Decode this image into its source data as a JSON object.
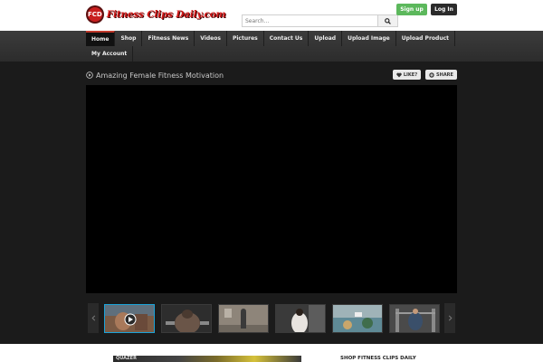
{
  "header": {
    "logo_badge": "FCD",
    "logo_text": "Fitness Clips Daily.com",
    "search_placeholder": "Search...",
    "signup_label": "Sign up",
    "login_label": "Log In"
  },
  "nav": {
    "items": [
      {
        "label": "Home",
        "active": true
      },
      {
        "label": "Shop"
      },
      {
        "label": "Fitness News"
      },
      {
        "label": "Videos"
      },
      {
        "label": "Pictures"
      },
      {
        "label": "Contact Us"
      },
      {
        "label": "Upload"
      },
      {
        "label": "Upload Image"
      },
      {
        "label": "Upload Product"
      }
    ],
    "second_row": [
      {
        "label": "My Account"
      }
    ]
  },
  "video": {
    "title": "Amazing Female Fitness Motivation",
    "like_label": "LIKE?",
    "share_label": "SHARE"
  },
  "footer": {
    "ad_text": "QUAZER",
    "shop_title": "SHOP FITNESS CLIPS DAILY"
  },
  "colors": {
    "accent_red": "#c0392b",
    "signup_green": "#5cb85c",
    "active_thumb_border": "#1aa3d9"
  },
  "icons": {
    "search": "search-icon",
    "play_circle": "play-circle-icon",
    "heart": "heart-icon",
    "plus": "plus-icon",
    "arrow_left": "chevron-left-icon",
    "arrow_right": "chevron-right-icon",
    "video_play": "video-play-icon"
  }
}
